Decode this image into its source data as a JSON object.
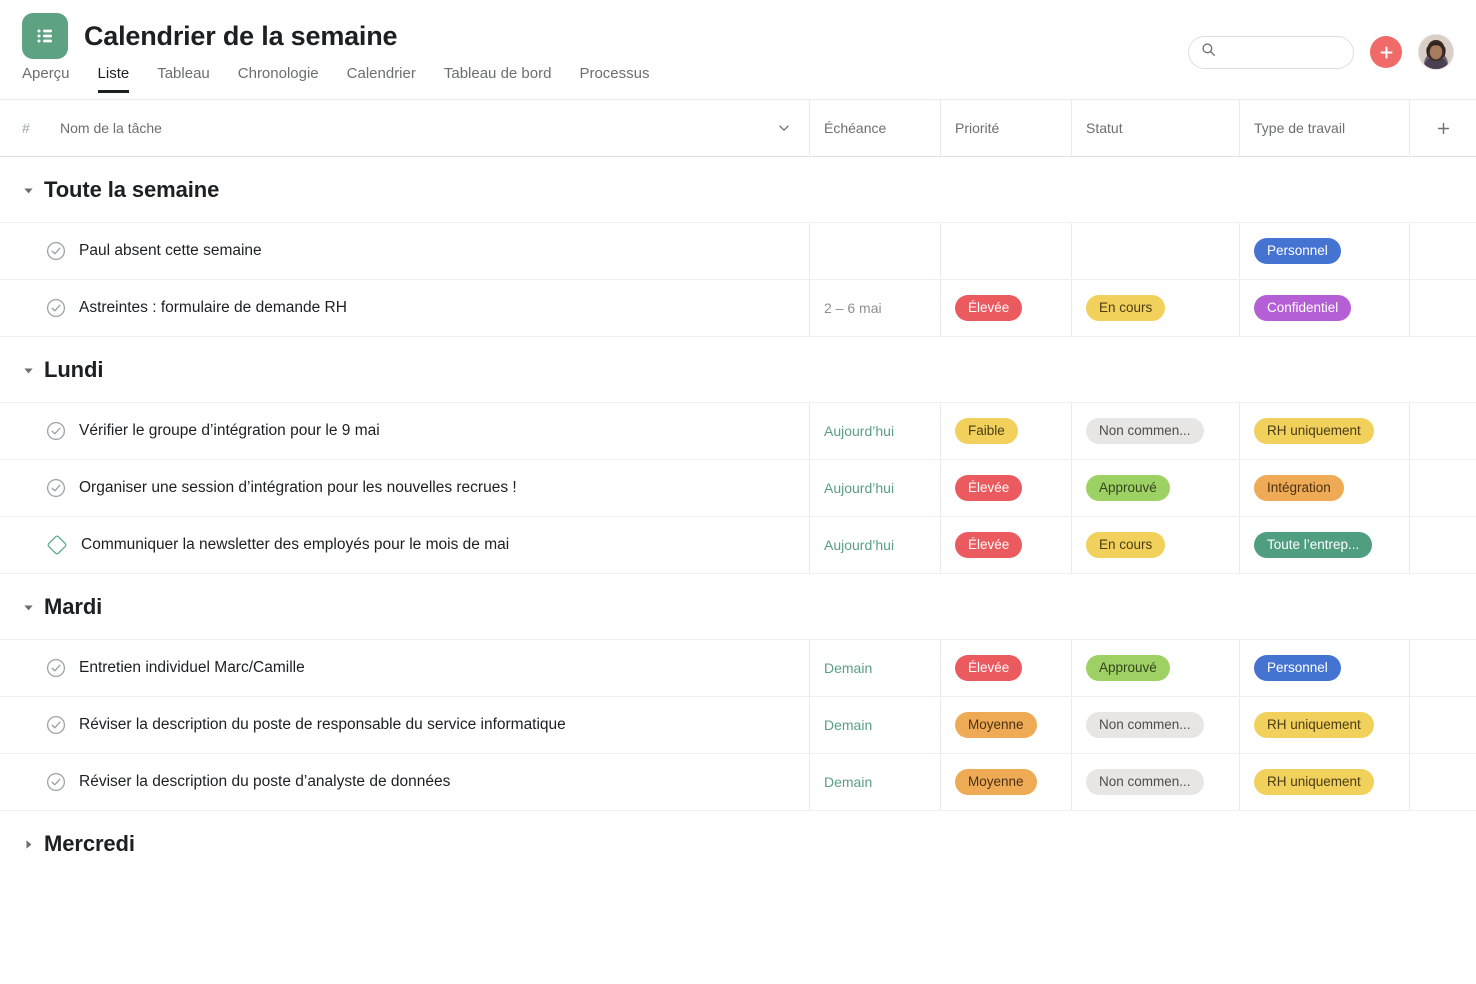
{
  "header": {
    "app_icon": "list-icon",
    "title": "Calendrier de la semaine",
    "tabs": [
      {
        "label": "Aperçu",
        "active": false
      },
      {
        "label": "Liste",
        "active": true
      },
      {
        "label": "Tableau",
        "active": false
      },
      {
        "label": "Chronologie",
        "active": false
      },
      {
        "label": "Calendrier",
        "active": false
      },
      {
        "label": "Tableau de bord",
        "active": false
      },
      {
        "label": "Processus",
        "active": false
      }
    ],
    "search": {
      "value": "",
      "placeholder": ""
    },
    "add_button_label": "+",
    "avatar_label": "avatar"
  },
  "columns": {
    "hash": "#",
    "name": "Nom de la tâche",
    "due": "Échéance",
    "priority": "Priorité",
    "status": "Statut",
    "work_type": "Type de travail",
    "add": "+"
  },
  "colors": {
    "brand_green": "#5da283",
    "accent_red": "#f06a6a",
    "pill_red": "#eb5a5e",
    "pill_yellow": "#f1d15b",
    "pill_orange": "#eeaa55",
    "pill_green": "#9ed164",
    "pill_grey": "#e8e6e4",
    "pill_blue": "#4573d2",
    "pill_purple": "#b55fd6",
    "pill_teal": "#4f9e80",
    "due_soon": "#5a9e87"
  },
  "sections": [
    {
      "title": "Toute la semaine",
      "expanded": true,
      "tasks": [
        {
          "icon": "check-circle-icon",
          "name": "Paul absent cette semaine",
          "due": "",
          "due_soon": false,
          "priority": null,
          "status": null,
          "work_type": {
            "label": "Personnel",
            "bg": "#4573d2",
            "fg": "#ffffff"
          }
        },
        {
          "icon": "check-circle-icon",
          "name": "Astreintes : formulaire de demande RH",
          "due": "2 – 6 mai",
          "due_soon": false,
          "priority": {
            "label": "Élevée",
            "bg": "#eb5a5e",
            "fg": "#ffffff"
          },
          "status": {
            "label": "En cours",
            "bg": "#f1d15b",
            "fg": "#4a3c16"
          },
          "work_type": {
            "label": "Confidentiel",
            "bg": "#b55fd6",
            "fg": "#ffffff"
          }
        }
      ]
    },
    {
      "title": "Lundi",
      "expanded": true,
      "tasks": [
        {
          "icon": "check-circle-icon",
          "name": "Vérifier le groupe d’intégration pour le 9 mai",
          "due": "Aujourd’hui",
          "due_soon": true,
          "priority": {
            "label": "Faible",
            "bg": "#f1d15b",
            "fg": "#4a3c16"
          },
          "status": {
            "label": "Non commen...",
            "bg": "#e8e6e4",
            "fg": "#4d4d4d"
          },
          "work_type": {
            "label": "RH uniquement",
            "bg": "#f1d15b",
            "fg": "#4a3c16"
          }
        },
        {
          "icon": "check-circle-icon",
          "name": "Organiser une session d’intégration pour les nouvelles recrues !",
          "due": "Aujourd’hui",
          "due_soon": true,
          "priority": {
            "label": "Élevée",
            "bg": "#eb5a5e",
            "fg": "#ffffff"
          },
          "status": {
            "label": "Approuvé",
            "bg": "#9ed164",
            "fg": "#33441c"
          },
          "work_type": {
            "label": "Intégration",
            "bg": "#eeaa55",
            "fg": "#4a3213"
          }
        },
        {
          "icon": "diamond-milestone-icon",
          "name": "Communiquer la newsletter des employés pour le mois de mai",
          "due": "Aujourd’hui",
          "due_soon": true,
          "priority": {
            "label": "Élevée",
            "bg": "#eb5a5e",
            "fg": "#ffffff"
          },
          "status": {
            "label": "En cours",
            "bg": "#f1d15b",
            "fg": "#4a3c16"
          },
          "work_type": {
            "label": "Toute l’entrep...",
            "bg": "#4f9e80",
            "fg": "#ffffff"
          }
        }
      ]
    },
    {
      "title": "Mardi",
      "expanded": true,
      "tasks": [
        {
          "icon": "check-circle-icon",
          "name": "Entretien individuel Marc/Camille",
          "due": "Demain",
          "due_soon": true,
          "priority": {
            "label": "Élevée",
            "bg": "#eb5a5e",
            "fg": "#ffffff"
          },
          "status": {
            "label": "Approuvé",
            "bg": "#9ed164",
            "fg": "#33441c"
          },
          "work_type": {
            "label": "Personnel",
            "bg": "#4573d2",
            "fg": "#ffffff"
          }
        },
        {
          "icon": "check-circle-icon",
          "name": "Réviser la description du poste de responsable du service informatique",
          "due": "Demain",
          "due_soon": true,
          "priority": {
            "label": "Moyenne",
            "bg": "#eeaa55",
            "fg": "#4a3213"
          },
          "status": {
            "label": "Non commen...",
            "bg": "#e8e6e4",
            "fg": "#4d4d4d"
          },
          "work_type": {
            "label": "RH uniquement",
            "bg": "#f1d15b",
            "fg": "#4a3c16"
          }
        },
        {
          "icon": "check-circle-icon",
          "name": "Réviser la description du poste d’analyste de données",
          "due": "Demain",
          "due_soon": true,
          "priority": {
            "label": "Moyenne",
            "bg": "#eeaa55",
            "fg": "#4a3213"
          },
          "status": {
            "label": "Non commen...",
            "bg": "#e8e6e4",
            "fg": "#4d4d4d"
          },
          "work_type": {
            "label": "RH uniquement",
            "bg": "#f1d15b",
            "fg": "#4a3c16"
          }
        }
      ]
    },
    {
      "title": "Mercredi",
      "expanded": false,
      "tasks": []
    }
  ]
}
